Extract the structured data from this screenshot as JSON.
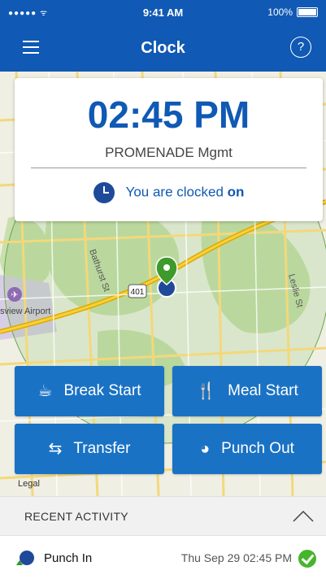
{
  "status_bar": {
    "signal": "●●●●● ᯤ",
    "time": "9:41 AM",
    "battery": "100%"
  },
  "nav": {
    "title": "Clock",
    "help_label": "?"
  },
  "timecard": {
    "time": "02:45 PM",
    "organization": "PROMENADE Mgmt",
    "status_prefix": "You are clocked",
    "status_value": "on"
  },
  "map": {
    "labels": {
      "bathurst": "Bathurst St",
      "airport": "sview Airport",
      "leslie": "Leslie St",
      "highway": "401",
      "legal": "Legal"
    }
  },
  "actions": {
    "break_start": "Break Start",
    "meal_start": "Meal Start",
    "transfer": "Transfer",
    "punch_out": "Punch Out"
  },
  "recent": {
    "header": "RECENT ACTIVITY",
    "items": [
      {
        "label": "Punch In",
        "timestamp": "Thu Sep 29 02:45 PM",
        "status": "confirmed"
      }
    ]
  },
  "colors": {
    "brand_blue": "#1059b4",
    "button_blue": "#1a72c4",
    "success_green": "#45b52c"
  }
}
